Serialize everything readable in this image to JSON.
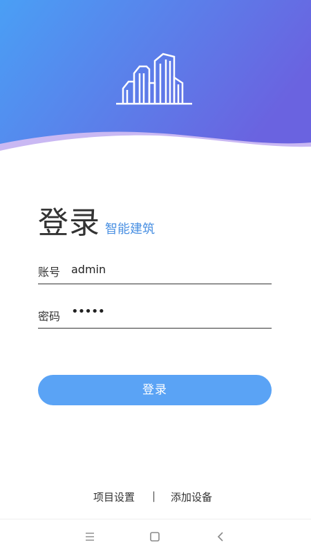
{
  "header": {
    "colors": {
      "gradient_start": "#4a9ff5",
      "gradient_end": "#6a63e0",
      "wave_accent": "#c9b8f3"
    },
    "logo_icon": "building-icon"
  },
  "login": {
    "title": "登录",
    "subtitle": "智能建筑",
    "account_label": "账号",
    "account_value": "admin",
    "password_label": "密码",
    "password_value": "•••••",
    "button_label": "登录"
  },
  "links": {
    "project_settings": "项目设置",
    "separator": "|",
    "add_device": "添加设备"
  },
  "navbar": {
    "menu_icon": "menu-icon",
    "home_icon": "home-icon",
    "back_icon": "back-icon"
  },
  "colors": {
    "accent": "#4a90e2",
    "button": "#5aa3f5"
  }
}
